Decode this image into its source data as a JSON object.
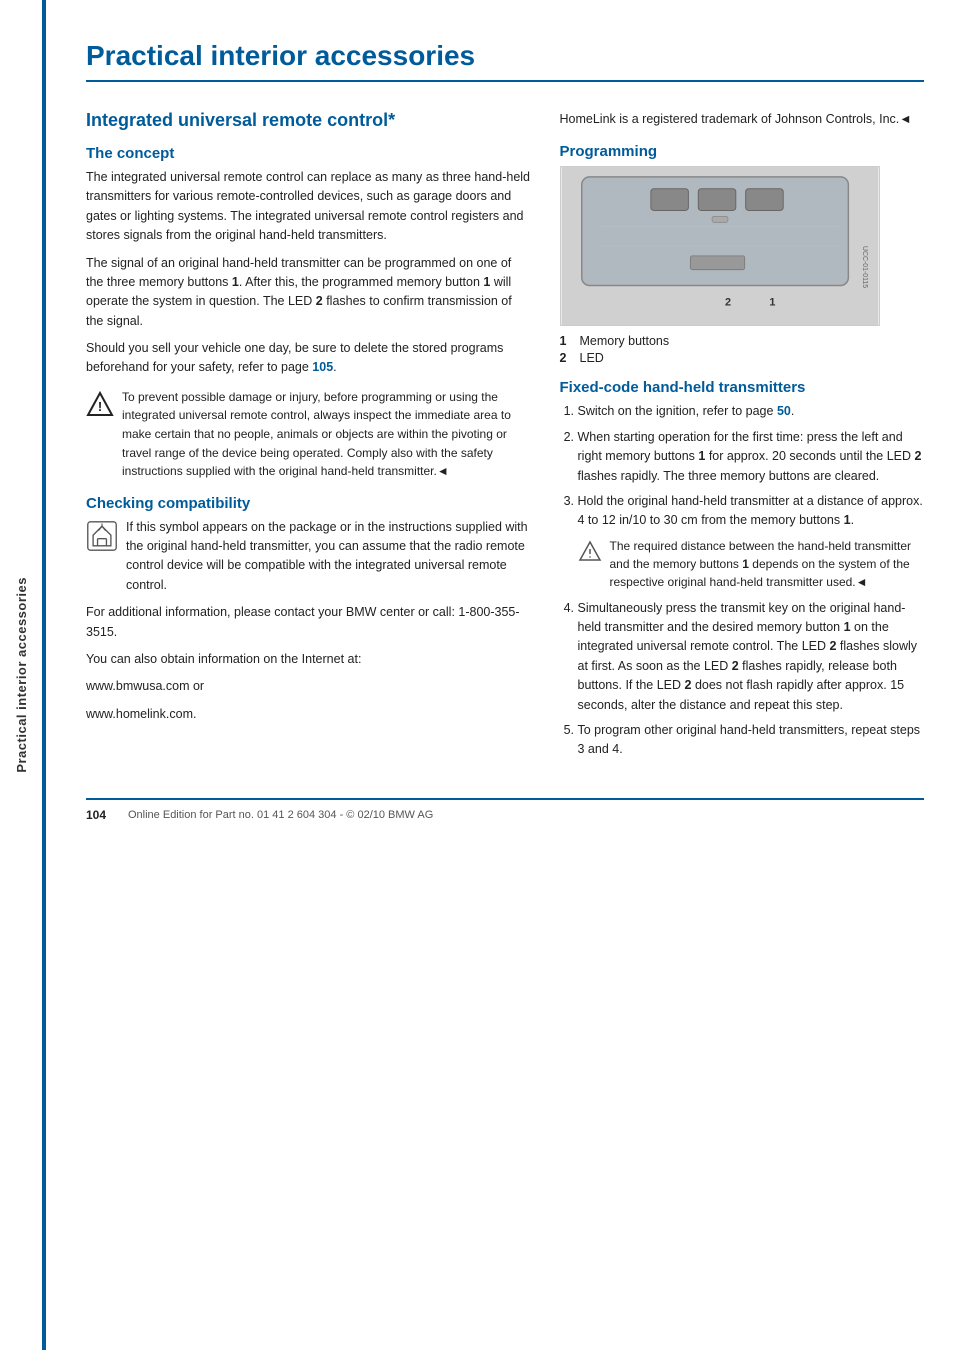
{
  "sidebar": {
    "label": "Practical interior accessories"
  },
  "page": {
    "title": "Practical interior accessories",
    "main_heading": "Integrated universal remote control*",
    "sections": {
      "concept": {
        "heading": "The concept",
        "paragraphs": [
          "The integrated universal remote control can replace as many as three hand-held transmitters for various remote-controlled devices, such as garage doors and gates or lighting systems. The integrated universal remote control registers and stores signals from the original hand-held transmitters.",
          "The signal of an original hand-held transmitter can be programmed on one of the three memory buttons 1. After this, the programmed memory button 1 will operate the system in question. The LED 2 flashes to confirm transmission of the signal.",
          "Should you sell your vehicle one day, be sure to delete the stored programs beforehand for your safety, refer to page 105."
        ],
        "warning": "To prevent possible damage or injury, before programming or using the integrated universal remote control, always inspect the immediate area to make certain that no people, animals or objects are within the pivoting or travel range of the device being operated. Comply also with the safety instructions supplied with the original hand-held transmitter.◄"
      },
      "compatibility": {
        "heading": "Checking compatibility",
        "compat_note": "If this symbol appears on the package or in the instructions supplied with the original hand-held transmitter, you can assume that the radio remote control device will be compatible with the integrated universal remote control.",
        "paragraphs": [
          "For additional information, please contact your BMW center or call: 1-800-355-3515.",
          "You can also obtain information on the Internet at:",
          "www.bmwusa.com or",
          "www.homelink.com."
        ]
      },
      "right_col": {
        "trademark_text": "HomeLink is a registered trademark of Johnson Controls, Inc.◄",
        "programming_heading": "Programming",
        "legend": [
          {
            "num": "1",
            "label": "Memory buttons"
          },
          {
            "num": "2",
            "label": "LED"
          }
        ],
        "fixed_code_heading": "Fixed-code hand-held transmitters",
        "steps": [
          "Switch on the ignition, refer to page 50.",
          "When starting operation for the first time: press the left and right memory buttons 1 for approx. 20 seconds until the LED 2 flashes rapidly. The three memory buttons are cleared.",
          "Hold the original hand-held transmitter at a distance of approx. 4 to 12 in/10 to 30 cm from the memory buttons 1.",
          "Simultaneously press the transmit key on the original hand-held transmitter and the desired memory button 1 on the integrated universal remote control. The LED 2 flashes slowly at first. As soon as the LED 2 flashes rapidly, release both buttons. If the LED 2 does not flash rapidly after approx. 15 seconds, alter the distance and repeat this step.",
          "To program other original hand-held transmitters, repeat steps 3 and 4."
        ],
        "note_step3": "The required distance between the hand-held transmitter and the memory buttons 1 depends on the system of the respective original hand-held transmitter used.◄"
      }
    }
  },
  "footer": {
    "page_number": "104",
    "text": "Online Edition for Part no. 01 41 2 604 304 - © 02/10 BMW AG"
  }
}
